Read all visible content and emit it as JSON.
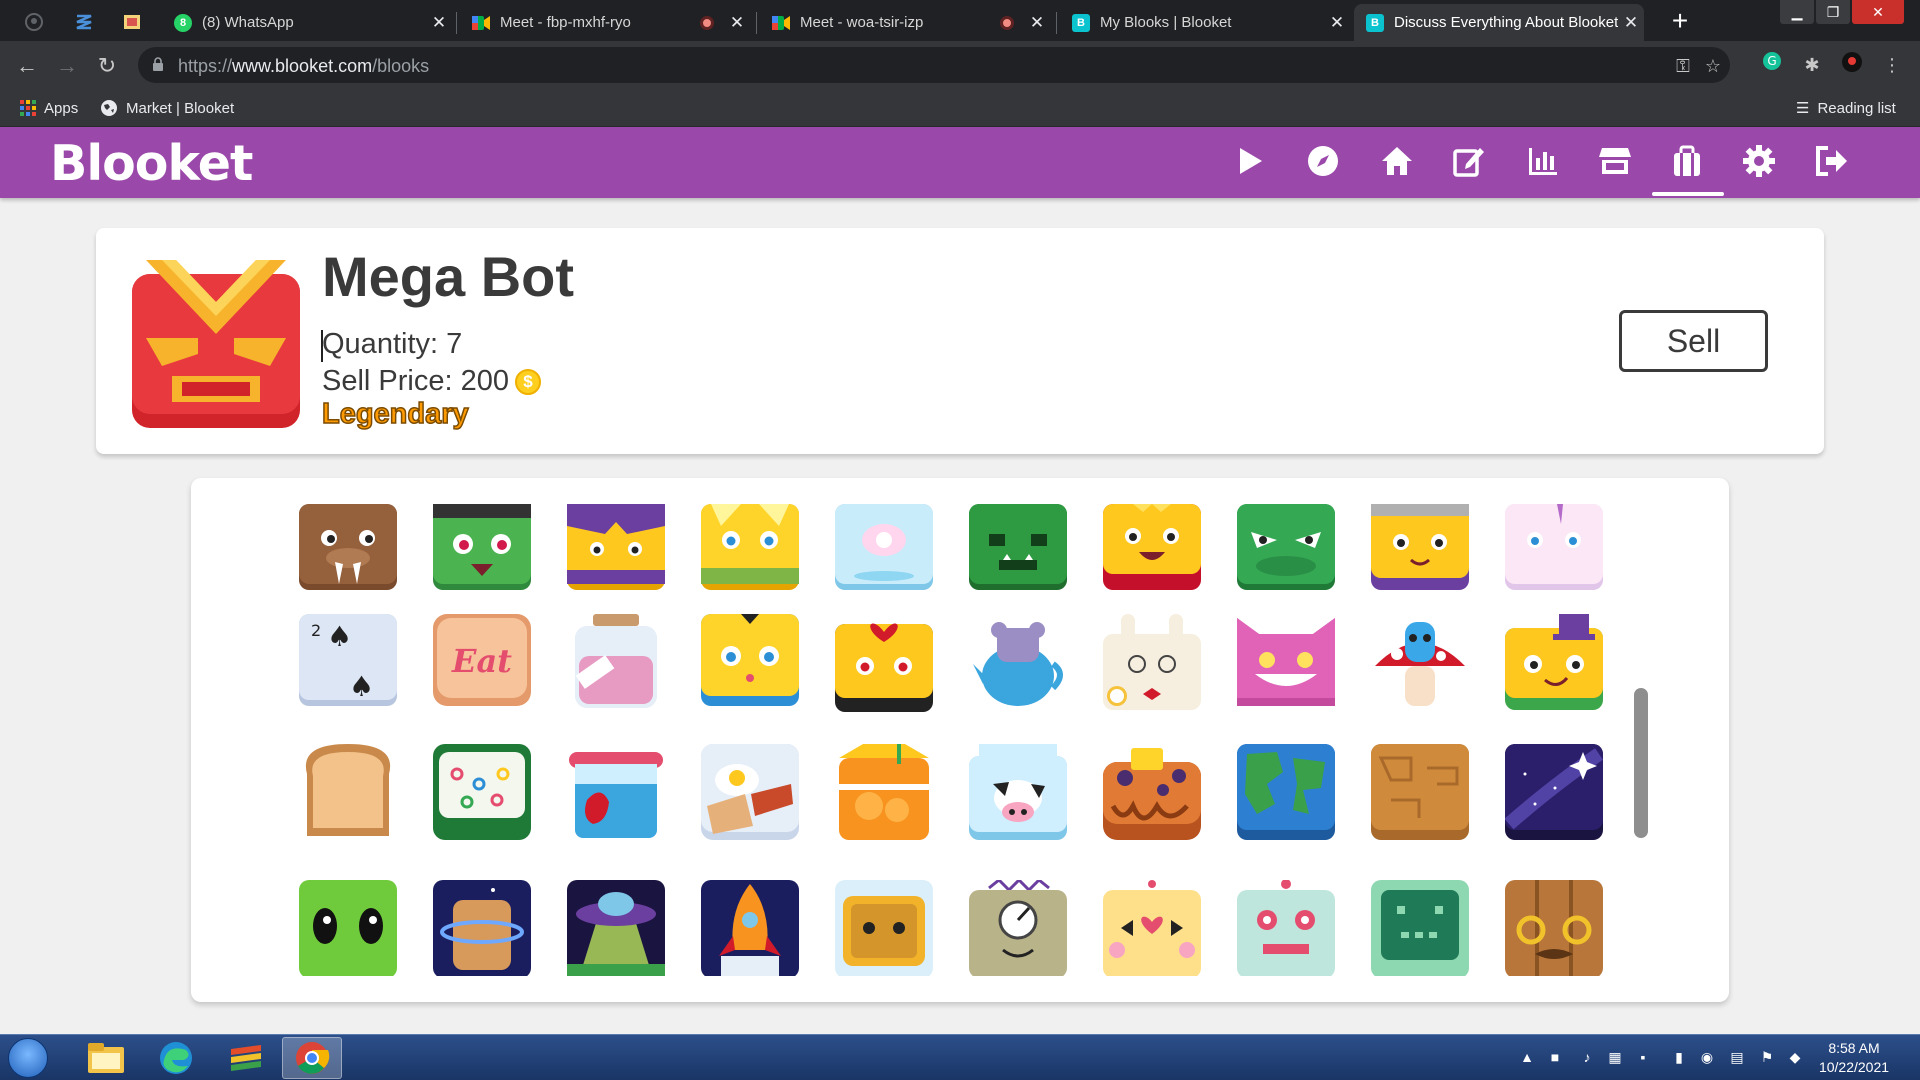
{
  "browser": {
    "tabs": [
      {
        "title": "(8) WhatsApp"
      },
      {
        "title": "Meet - fbp-mxhf-ryo"
      },
      {
        "title": "Meet - woa-tsir-izp"
      },
      {
        "title": "My Blooks | Blooket"
      },
      {
        "title": "Discuss Everything About Blooket"
      }
    ],
    "url_scheme": "https://",
    "url_domain": "www.blooket.com",
    "url_path": "/blooks",
    "bookmarks": {
      "apps": "Apps",
      "market": "Market | Blooket",
      "reading_list": "Reading list"
    }
  },
  "site": {
    "brand": "Blooket",
    "accent_color": "#9a49aa",
    "nav_icons": [
      "play-icon",
      "compass-icon",
      "home-icon",
      "edit-icon",
      "stats-icon",
      "market-icon",
      "blooks-icon",
      "settings-icon",
      "logout-icon"
    ],
    "active_nav": "blooks-icon"
  },
  "blook": {
    "name": "Mega Bot",
    "quantity_text": "Quantity: 7",
    "sell_price_text": "Sell Price: 200",
    "coin_symbol": "$",
    "rarity": "Legendary",
    "sell_label": "Sell"
  },
  "taskbar": {
    "time": "8:58 AM",
    "date": "10/22/2021"
  }
}
